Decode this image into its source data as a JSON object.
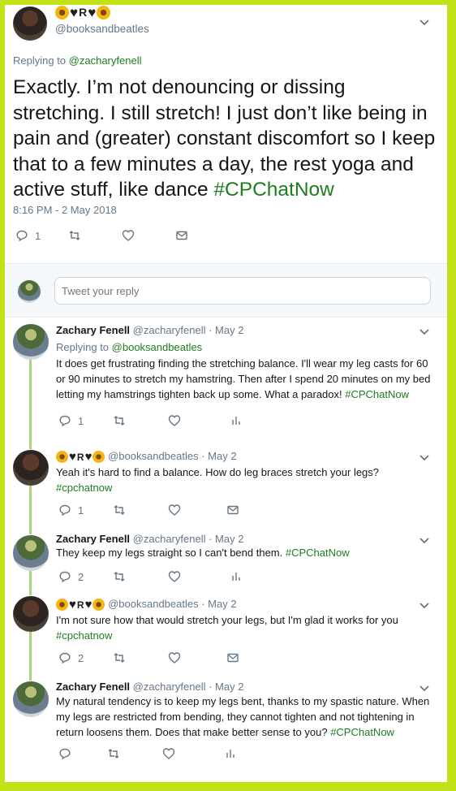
{
  "main_tweet": {
    "handle": "@booksandbeatles",
    "reply_prefix": "Replying to",
    "reply_to": "@zacharyfenell",
    "text": "Exactly. I’m not denouncing or dissing stretching. I still stretch! I just don’t like being in pain and (greater) constant discomfort so I keep that to a few minutes a day, the rest yoga and active stuff, like dance ",
    "hashtag": "#CPChatNow",
    "timestamp": "8:16 PM - 2 May 2018",
    "reply_count": "1"
  },
  "composer": {
    "placeholder": "Tweet your reply"
  },
  "replies": [
    {
      "display_name": "Zachary Fenell",
      "handle": "@zacharyfenell",
      "date": "· May 2",
      "reply_prefix": "Replying to",
      "reply_to": "@booksandbeatles",
      "text": "It does get frustrating finding the stretching balance. I'll wear my leg casts for 60 or 90 minutes to stretch my hamstring. Then after I spend 20 minutes on my bed letting my hamstrings tighten back up some. What a paradox! ",
      "hashtag": "#CPChatNow",
      "reply_count": "1"
    },
    {
      "handle": "@booksandbeatles",
      "date": "· May 2",
      "text": "Yeah it's hard to find a balance. How do leg braces stretch your legs? ",
      "hashtag": "#cpchatnow",
      "reply_count": "1"
    },
    {
      "display_name": "Zachary Fenell",
      "handle": "@zacharyfenell",
      "date": "· May 2",
      "text": "They keep my legs straight so I can't bend them. ",
      "hashtag": "#CPChatNow",
      "reply_count": "2"
    },
    {
      "handle": "@booksandbeatles",
      "date": "· May 2",
      "text": "I'm not sure how that would stretch your legs, but I'm glad it works for you ",
      "hashtag": "#cpchatnow",
      "reply_count": "2"
    },
    {
      "display_name": "Zachary Fenell",
      "handle": "@zacharyfenell",
      "date": "· May 2",
      "text": "My natural tendency is to keep my legs bent, thanks to my spastic nature. When my legs are restricted from bending, they cannot tighten and not tightening in return loosens them. Does that make better sense to you? ",
      "hashtag": "#CPChatNow",
      "reply_count": ""
    }
  ],
  "colors": {
    "border_green": "#c3e117",
    "link_green": "#1e7d1e",
    "muted": "#657786",
    "thread_line": "#a7d57a"
  },
  "icons": {
    "reply": "speech-bubble-icon",
    "retweet": "retweet-arrows-icon",
    "like": "heart-outline-icon",
    "dm": "envelope-icon",
    "analytics": "bar-chart-icon",
    "caret": "chevron-down-icon"
  }
}
